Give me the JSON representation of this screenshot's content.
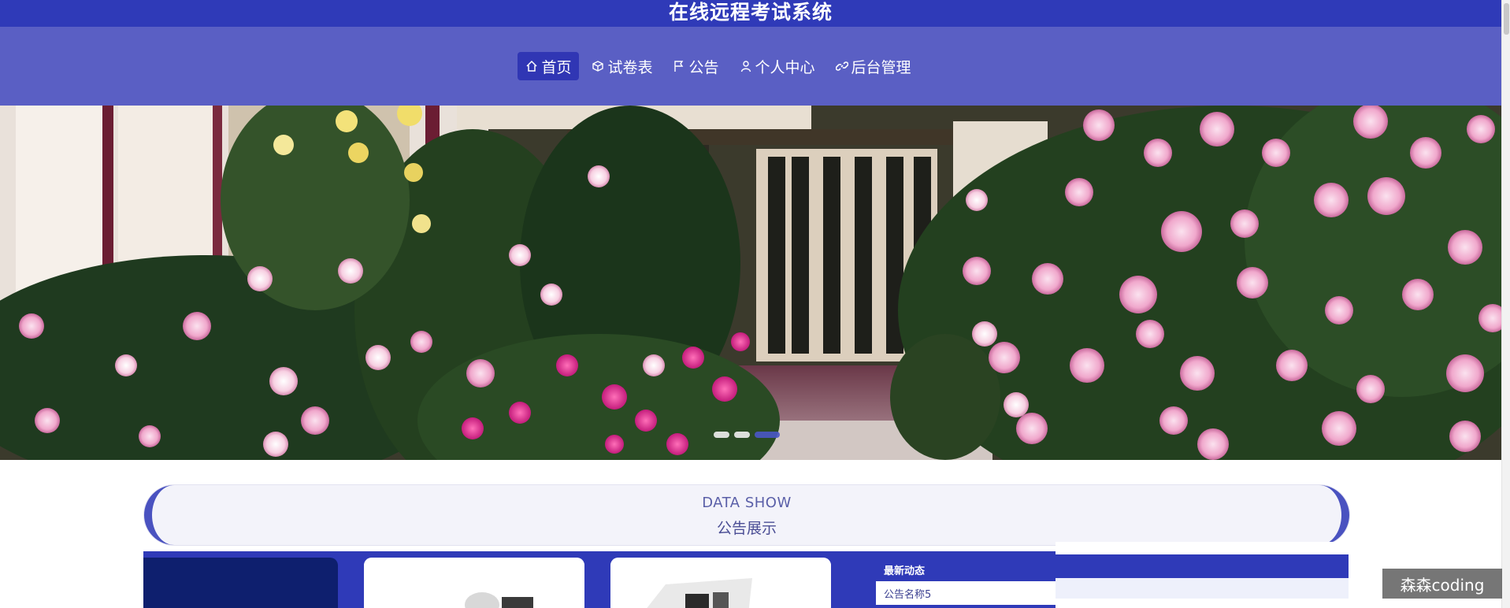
{
  "header": {
    "title": "在线远程考试系统"
  },
  "nav": {
    "items": [
      {
        "label": "首页",
        "icon": "home-icon",
        "active": true
      },
      {
        "label": "试卷表",
        "icon": "box-icon",
        "active": false
      },
      {
        "label": "公告",
        "icon": "flag-icon",
        "active": false
      },
      {
        "label": "个人中心",
        "icon": "user-icon",
        "active": false
      },
      {
        "label": "后台管理",
        "icon": "link-icon",
        "active": false
      }
    ]
  },
  "banner": {
    "slide_count": 3,
    "active_slide": 3
  },
  "section": {
    "title_en": "DATA SHOW",
    "title_cn": "公告展示"
  },
  "latest": {
    "title": "最新动态",
    "first_item": "公告名称5"
  },
  "watermark": "森森coding",
  "colors": {
    "primary": "#2f3ab8",
    "nav": "#5a5fc4",
    "accent": "#4a52c0"
  }
}
